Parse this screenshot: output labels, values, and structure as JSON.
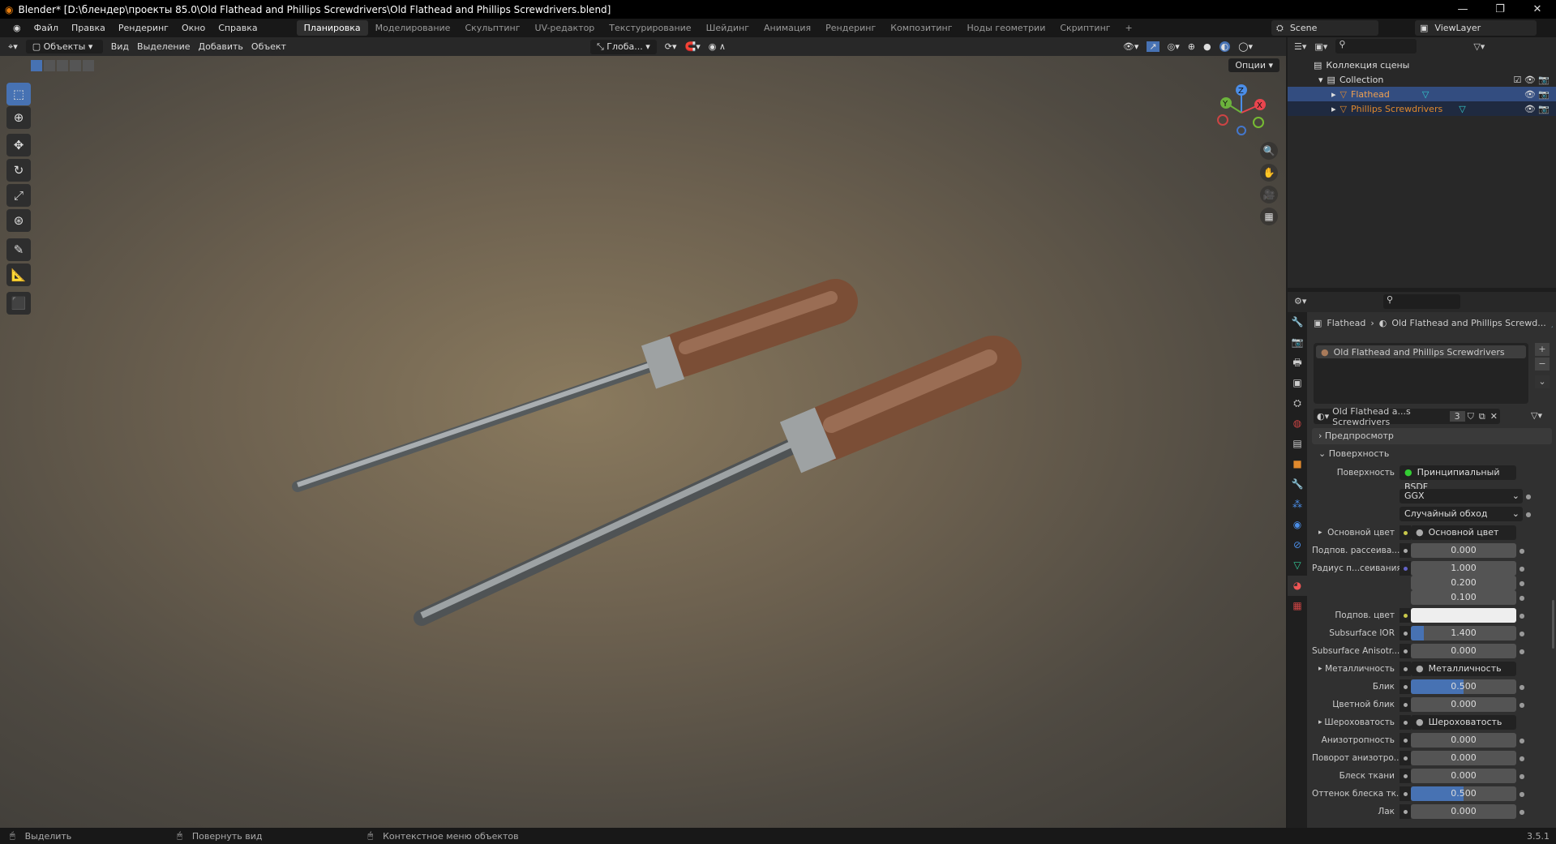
{
  "title": "Blender* [D:\\блендер\\проекты 85.0\\Old Flathead and Phillips Screwdrivers\\Old Flathead and Phillips Screwdrivers.blend]",
  "menu": [
    "Файл",
    "Правка",
    "Рендеринг",
    "Окно",
    "Справка"
  ],
  "workspaces": [
    "Планировка",
    "Моделирование",
    "Скульптинг",
    "UV-редактор",
    "Текстурирование",
    "Шейдинг",
    "Анимация",
    "Рендеринг",
    "Композитинг",
    "Ноды геометрии",
    "Скриптинг",
    "+"
  ],
  "scene": "Scene",
  "view_layer": "ViewLayer",
  "viewport_header": {
    "mode": "Объекты",
    "menus": [
      "Вид",
      "Выделение",
      "Добавить",
      "Объект"
    ],
    "orientation": "Глоба...",
    "options": "Опции"
  },
  "outliner": {
    "root": "Коллекция сцены",
    "collection": "Collection",
    "items": [
      "Flathead",
      "Phillips Screwdrivers"
    ]
  },
  "properties": {
    "breadcrumb_object": "Flathead",
    "breadcrumb_material": "Old Flathead and Phillips Screwd...",
    "slot": "Old Flathead and Phillips Screwdrivers",
    "material_name": "Old Flathead a...s Screwdrivers",
    "users": "3",
    "panels": {
      "preview": "Предпросмотр",
      "surface": "Поверхность"
    },
    "surface_label": "Поверхность",
    "surface_value": "Принципиальный BSDF",
    "distribution": "GGX",
    "sss_method": "Случайный обход",
    "rows": [
      {
        "label": "Основной цвет",
        "link": "Основной цвет",
        "expand": true,
        "sock": "#c8c84a"
      },
      {
        "label": "Подпов. рассеива...",
        "value": "0.000",
        "fill": 0,
        "sock": "#aaa"
      },
      {
        "label": "Радиус п...сеивания",
        "value": "1.000",
        "fill": 0,
        "sock": "#6363c7"
      },
      {
        "label": "",
        "value": "0.200",
        "fill": 0
      },
      {
        "label": "",
        "value": "0.100",
        "fill": 0
      },
      {
        "label": "Подпов. цвет",
        "value": "",
        "white": true,
        "sock": "#c8c84a"
      },
      {
        "label": "Subsurface IOR",
        "value": "1.400",
        "fill": 0.12,
        "sock": "#aaa"
      },
      {
        "label": "Subsurface Anisotr...",
        "value": "0.000",
        "fill": 0,
        "sock": "#aaa"
      },
      {
        "label": "Металличность",
        "link": "Металличность",
        "expand": true,
        "sock": "#aaa"
      },
      {
        "label": "Блик",
        "value": "0.500",
        "fill": 0.5,
        "sock": "#aaa"
      },
      {
        "label": "Цветной блик",
        "value": "0.000",
        "fill": 0,
        "sock": "#aaa"
      },
      {
        "label": "Шероховатость",
        "link": "Шероховатость",
        "expand": true,
        "sock": "#aaa"
      },
      {
        "label": "Анизотропность",
        "value": "0.000",
        "fill": 0,
        "sock": "#aaa"
      },
      {
        "label": "Поворот анизотро...",
        "value": "0.000",
        "fill": 0,
        "sock": "#aaa"
      },
      {
        "label": "Блеск ткани",
        "value": "0.000",
        "fill": 0,
        "sock": "#aaa"
      },
      {
        "label": "Оттенок блеска тк...",
        "value": "0.500",
        "fill": 0.5,
        "sock": "#aaa"
      },
      {
        "label": "Лак",
        "value": "0.000",
        "fill": 0,
        "sock": "#aaa"
      }
    ]
  },
  "status": {
    "select": "Выделить",
    "rotate": "Повернуть вид",
    "context": "Контекстное меню объектов",
    "version": "3.5.1"
  },
  "colors": {
    "accent": "#4772b3",
    "selected_row": "#334d80",
    "object_orange": "#e0892d"
  }
}
